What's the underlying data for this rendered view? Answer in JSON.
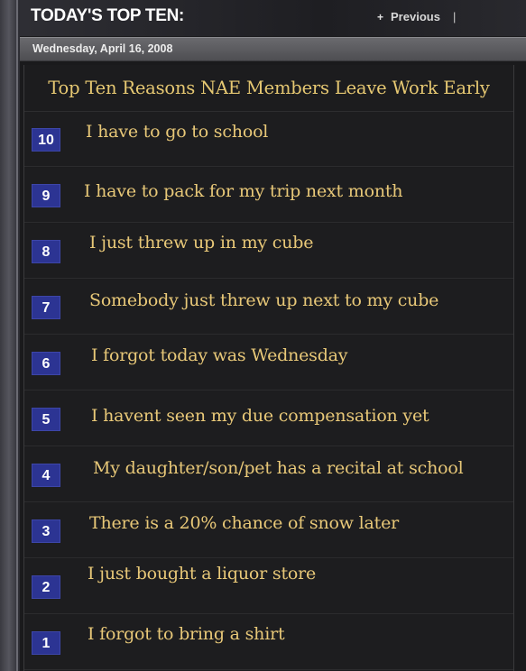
{
  "header": {
    "title": "TODAY'S TOP TEN:",
    "previous_label": "Previous"
  },
  "date": "Wednesday, April 16, 2008",
  "list": {
    "title": "Top Ten Reasons NAE Members Leave Work Early",
    "items": [
      {
        "rank": "10",
        "text": "I have to go to school"
      },
      {
        "rank": "9",
        "text": "I have to pack for my trip next month"
      },
      {
        "rank": "8",
        "text": "I just threw up in my cube"
      },
      {
        "rank": "7",
        "text": "Somebody just threw up next to my cube"
      },
      {
        "rank": "6",
        "text": "I forgot today was Wednesday"
      },
      {
        "rank": "5",
        "text": "I havent seen my due compensation yet"
      },
      {
        "rank": "4",
        "text": "My daughter/son/pet has a recital at school"
      },
      {
        "rank": "3",
        "text": "There is a 20% chance of snow later"
      },
      {
        "rank": "2",
        "text": "I just bought a liquor store"
      },
      {
        "rank": "1",
        "text": "I forgot to bring a shirt"
      }
    ]
  },
  "colors": {
    "rank_badge": "#2c3493",
    "reason_text": "#e8c878"
  }
}
